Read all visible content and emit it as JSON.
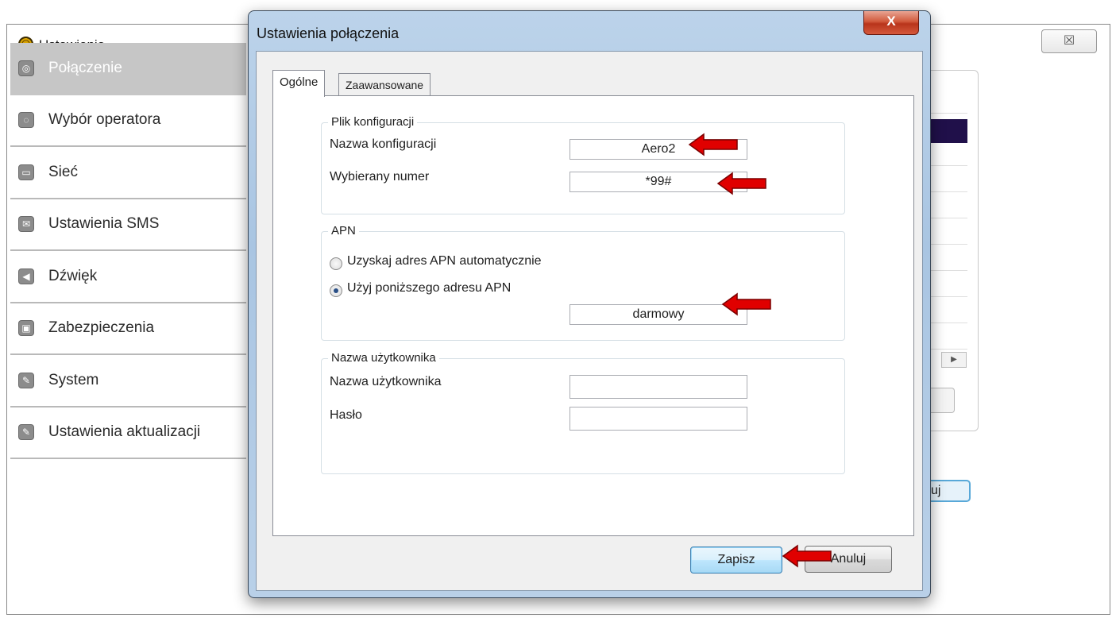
{
  "background_window": {
    "title": "Ustawienia",
    "close_glyph": "☒",
    "nav_items": [
      {
        "label": "Połączenie",
        "icon": "globe-icon",
        "active": true
      },
      {
        "label": "Wybór operatora",
        "icon": "operator-icon",
        "active": false
      },
      {
        "label": "Sieć",
        "icon": "network-icon",
        "active": false
      },
      {
        "label": "Ustawienia SMS",
        "icon": "envelope-icon",
        "active": false
      },
      {
        "label": "Dźwięk",
        "icon": "speaker-icon",
        "active": false
      },
      {
        "label": "Zabezpieczenia",
        "icon": "lock-icon",
        "active": false
      },
      {
        "label": "System",
        "icon": "tools-icon",
        "active": false
      },
      {
        "label": "Ustawienia aktualizacji",
        "icon": "update-tools-icon",
        "active": false
      }
    ],
    "partial_button_text": "uj"
  },
  "dialog": {
    "title": "Ustawienia połączenia",
    "close_glyph": "X",
    "tabs": [
      {
        "label": "Ogólne",
        "active": true
      },
      {
        "label": "Zaawansowane",
        "active": false
      }
    ],
    "config_group": {
      "legend": "Plik konfiguracji",
      "name_label": "Nazwa konfiguracji",
      "name_value": "Aero2",
      "number_label": "Wybierany numer",
      "number_value": "*99#"
    },
    "apn_group": {
      "legend": "APN",
      "auto_label": "Uzyskaj adres APN automatycznie",
      "manual_label": "Użyj poniższego adresu APN",
      "selected": "manual",
      "apn_value": "darmowy"
    },
    "user_group": {
      "legend": "Nazwa użytkownika",
      "username_label": "Nazwa użytkownika",
      "username_value": "",
      "password_label": "Hasło",
      "password_value": ""
    },
    "buttons": {
      "save": "Zapisz",
      "cancel": "Anuluj"
    }
  },
  "colors": {
    "annotation_arrow": "#e00000",
    "dialog_frame": "#b4cde6",
    "close_button": "#c8452a"
  }
}
